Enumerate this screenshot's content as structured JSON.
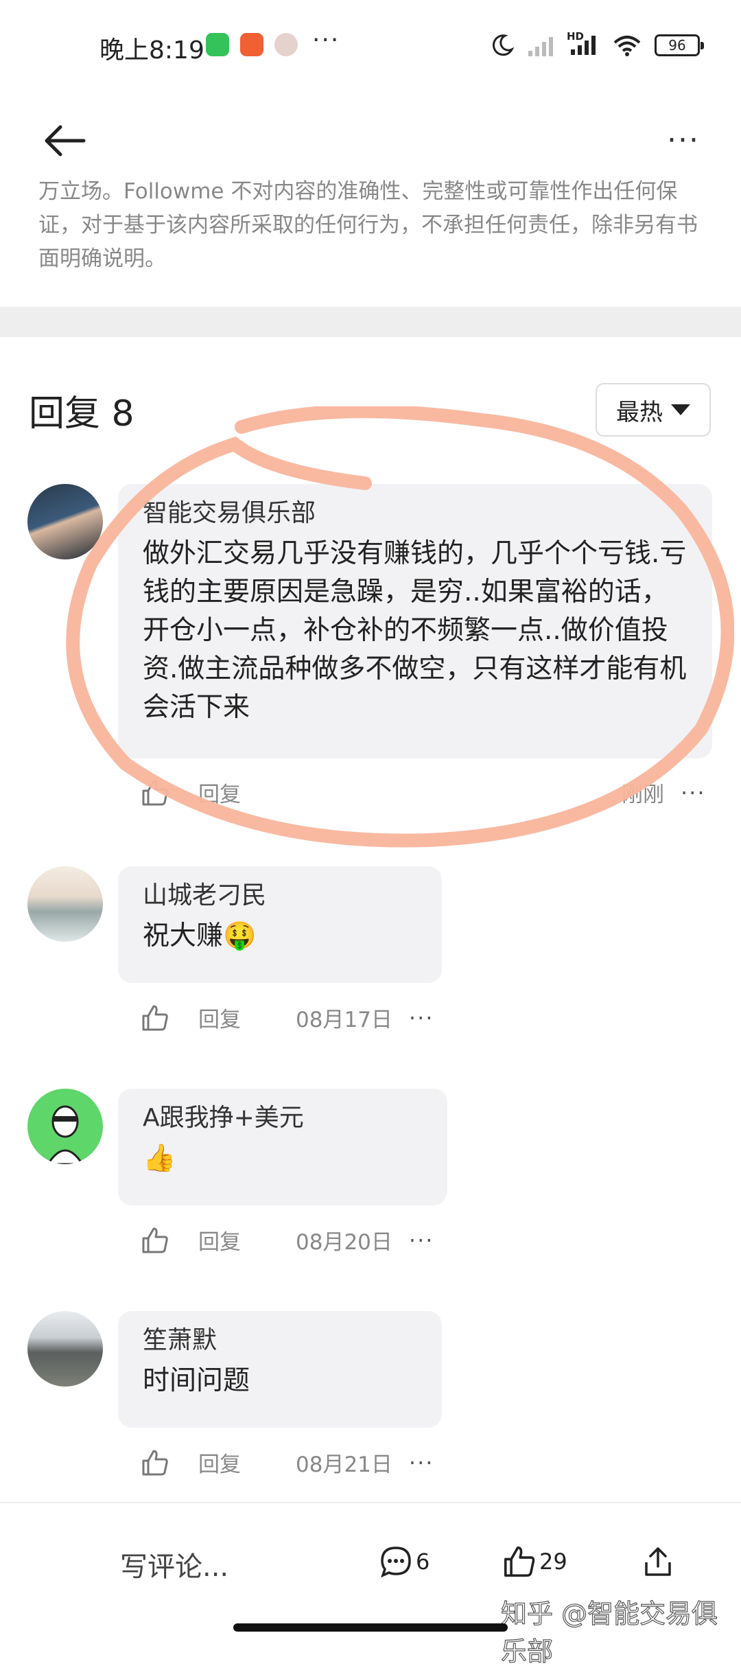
{
  "status_bar": {
    "time": "晚上8:19",
    "network": "HD",
    "battery": "96"
  },
  "header": {
    "back_icon": "arrow-left-icon",
    "more_icon": "more-horizontal-icon"
  },
  "disclaimer": "万立场。Followme 不对内容的准确性、完整性或可靠性作出任何保证，对于基于该内容所采取的任何行为，不承担任何责任，除非另有书面明确说明。",
  "replies": {
    "title": "回复 8",
    "sort_label": "最热"
  },
  "comments": [
    {
      "name": "智能交易俱乐部",
      "text": "做外汇交易几乎没有赚钱的，几乎个个亏钱.亏钱的主要原因是急躁，是穷..如果富裕的话，开仓小一点，补仓补的不频繁一点..做价值投资.做主流品种做多不做空，只有这样才能有机会活下来",
      "reply_label": "回复",
      "time": "刚刚"
    },
    {
      "name": "山城老刁民",
      "text": "祝大赚🤑",
      "reply_label": "回复",
      "time": "08月17日"
    },
    {
      "name": "A跟我挣+美元",
      "text": "👍",
      "reply_label": "回复",
      "time": "08月20日"
    },
    {
      "name": "笙萧默",
      "text": "时间问题",
      "reply_label": "回复",
      "time": "08月21日"
    }
  ],
  "bottom_bar": {
    "write_placeholder": "写评论...",
    "comment_count": "6",
    "like_count": "29",
    "watermark": "知乎 @智能交易俱乐部"
  },
  "colors": {
    "highlight_circle": "#f9b59c",
    "bubble_bg": "#f2f2f4"
  }
}
